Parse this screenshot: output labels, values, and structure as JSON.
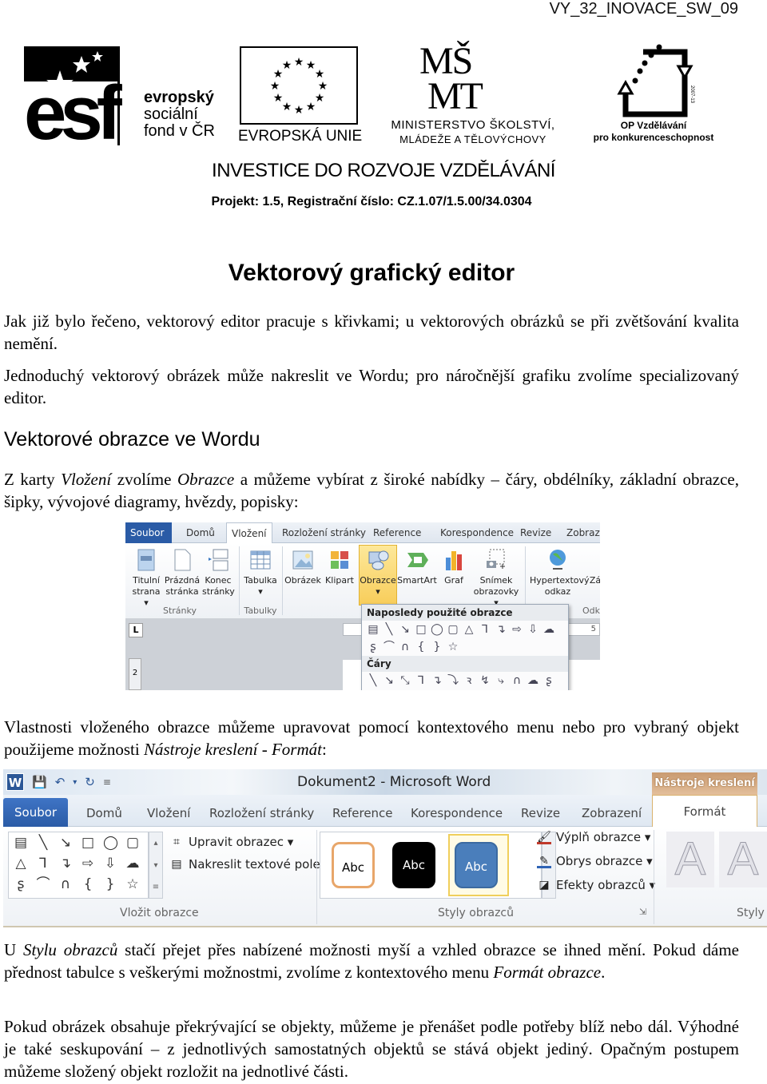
{
  "header": {
    "doc_id": "VY_32_INOVACE_SW_09",
    "logos": {
      "esf": {
        "letters": "esf",
        "line1": "evropský",
        "line2": "sociální",
        "line3": "fond v ČR"
      },
      "eu": {
        "label": "EVROPSKÁ UNIE"
      },
      "msmt": {
        "mark_top": "MŠ",
        "mark_bottom": "MT",
        "line1": "MINISTERSTVO ŠKOLSTVÍ,",
        "line2": "MLÁDEŽE A TĚLOVÝCHOVY"
      },
      "op": {
        "year": "2007-13",
        "line1": "OP Vzdělávání",
        "line2": "pro konkurenceschopnost"
      }
    },
    "investice": "INVESTICE DO ROZVOJE VZDĚLÁVÁNÍ",
    "projekt": "Projekt:  1.5, Registrační číslo: CZ.1.07/1.5.00/34.0304"
  },
  "document": {
    "title": "Vektorový grafický editor",
    "p1": "Jak již bylo řečeno, vektorový editor pracuje s křivkami; u vektorových obrázků se při zvětšování kvalita nemění.",
    "p2": "Jednoduchý vektorový obrázek může nakreslit ve Wordu; pro náročnější grafiku zvolíme specializovaný editor.",
    "section_heading": "Vektorové obrazce ve Wordu",
    "p3": {
      "a": "Z karty ",
      "b_italic": "Vložení",
      "c": " zvolíme ",
      "d_italic": "Obrazce",
      "e": " a můžeme vybírat z široké nabídky – čáry, obdélníky, základní obrazce, šipky, vývojové diagramy, hvězdy, popisky:"
    },
    "p4": {
      "a": "Vlastnosti vloženého obrazce můžeme upravovat pomocí kontextového menu nebo pro vybraný objekt použijeme možnosti ",
      "b_italic": "Nástroje kreslení - Formát",
      "c": ":"
    },
    "p5": {
      "a": "U ",
      "b_italic": "Stylu obrazců",
      "c": " stačí přejet přes nabízené možnosti myší a vzhled obrazce se ihned mění. Pokud dáme přednost tabulce s veškerými možnostmi, zvolíme z kontextového menu ",
      "d_italic": "Formát obrazce",
      "e": "."
    },
    "p6": "Pokud obrázek obsahuje překrývající se objekty, můžeme je přenášet podle potřeby blíž nebo dál. Výhodné je také seskupování – z jednotlivých samostatných objektů se stává objekt jediný. Opačným postupem můžeme složený objekt rozložit na jednotlivé části."
  },
  "screenshot1": {
    "tabs": [
      "Soubor",
      "Domů",
      "Vložení",
      "Rozložení stránky",
      "Reference",
      "Korespondence",
      "Revize",
      "Zobraze"
    ],
    "buttons": [
      {
        "label": "Titulní strana ▾",
        "icon": "cover-page-icon"
      },
      {
        "label": "Prázdná stránka",
        "icon": "blank-page-icon"
      },
      {
        "label": "Konec stránky",
        "icon": "page-break-icon"
      },
      {
        "label": "Tabulka ▾",
        "icon": "table-icon"
      },
      {
        "label": "Obrázek",
        "icon": "picture-icon"
      },
      {
        "label": "Klipart",
        "icon": "clipart-icon"
      },
      {
        "label": "Obrazce ▾",
        "icon": "shapes-icon"
      },
      {
        "label": "SmartArt",
        "icon": "smartart-icon"
      },
      {
        "label": "Graf",
        "icon": "chart-icon"
      },
      {
        "label": "Snímek obrazovky ▾",
        "icon": "screenshot-icon"
      },
      {
        "label": "Hypertextový odkaz",
        "icon": "hyperlink-icon"
      },
      {
        "label": "Zá",
        "icon": "bookmark-icon"
      }
    ],
    "groups": [
      "Stránky",
      "Tabulky",
      "Odk"
    ],
    "ruler_corner": "L",
    "vruler_mark": "2",
    "hruler_mark": "5",
    "dropdown": {
      "recent_heading": "Naposledy použité obrazce",
      "recent_row1": [
        "▤",
        "╲",
        "↘",
        "□",
        "◯",
        "▢",
        "△",
        "⅂",
        "↴",
        "⇨",
        "⇩",
        "☁"
      ],
      "recent_row2": [
        "ʂ",
        "⌒",
        "∩",
        "{",
        "}",
        "☆"
      ],
      "lines_heading": "Čáry",
      "lines_row": [
        "╲",
        "↘",
        "⤡",
        "⅂",
        "↴",
        "⤵",
        "ꝛ",
        "↯",
        "⤷",
        "∩",
        "☁",
        "ʂ"
      ]
    }
  },
  "screenshot2": {
    "window_title": "Dokument2 - Microsoft Word",
    "word_icon": "W",
    "context_tab_header": "Nástroje kreslení",
    "tabs": [
      "Soubor",
      "Domů",
      "Vložení",
      "Rozložení stránky",
      "Reference",
      "Korespondence",
      "Revize",
      "Zobrazení",
      "Formát"
    ],
    "shape_gallery": [
      [
        "▤",
        "╲",
        "↘",
        "□",
        "◯",
        "▢"
      ],
      [
        "△",
        "⅂",
        "↴",
        "⇨",
        "⇩",
        "☁"
      ],
      [
        "ʂ",
        "⌒",
        "∩",
        "{",
        "}",
        "☆"
      ]
    ],
    "commands_left": [
      {
        "label": "Upravit obrazec ▾",
        "icon": "edit-shape-icon"
      },
      {
        "label": "Nakreslit textové pole",
        "icon": "text-box-icon"
      }
    ],
    "group_insert_label": "Vložit obrazce",
    "style_samples": [
      "Abc",
      "Abc",
      "Abc"
    ],
    "commands_right": [
      {
        "label": "Výplň obrazce ▾",
        "icon": "fill-icon"
      },
      {
        "label": "Obrys obrazce ▾",
        "icon": "outline-icon"
      },
      {
        "label": "Efekty obrazců ▾",
        "icon": "effects-icon"
      }
    ],
    "group_styles_label": "Styly obrazců",
    "wordart_samples": [
      "A",
      "A"
    ],
    "group_wordart_label": "Styly"
  }
}
